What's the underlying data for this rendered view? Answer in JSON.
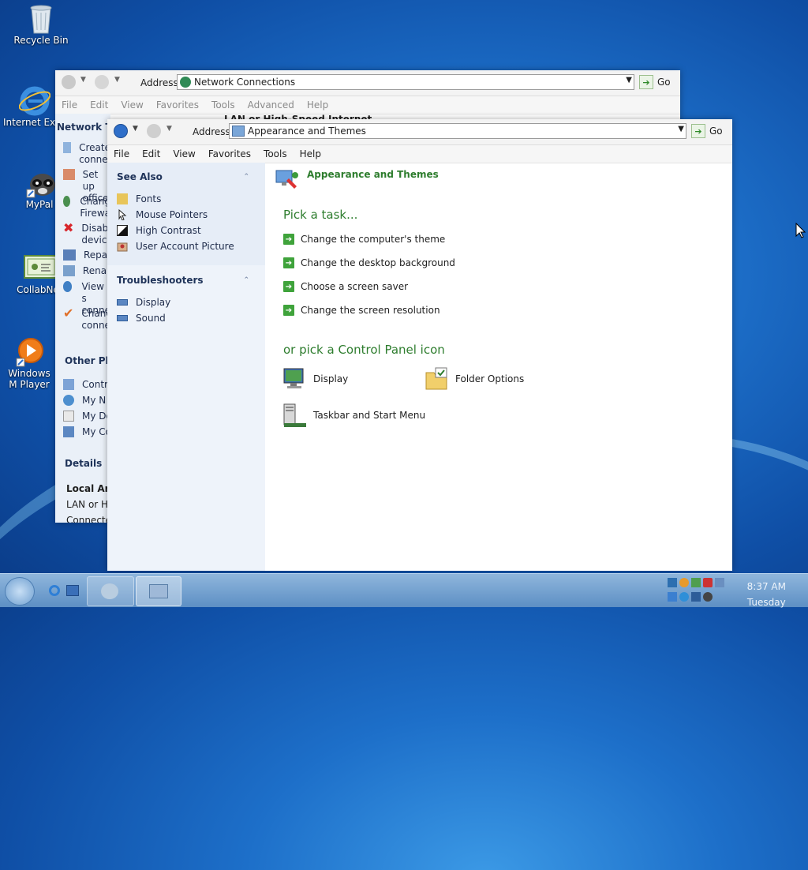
{
  "desktop": {
    "icons": [
      {
        "label": "Recycle Bin"
      },
      {
        "label": "Internet Expl"
      },
      {
        "label": "MyPal"
      },
      {
        "label": "CollabNe"
      },
      {
        "label": "Windows M Player"
      }
    ]
  },
  "back_window": {
    "address_label": "Address",
    "address_value": "Network Connections",
    "go_label": "Go",
    "menu": [
      "File",
      "Edit",
      "View",
      "Favorites",
      "Tools",
      "Advanced",
      "Help"
    ],
    "content_header": "LAN or High-Speed Internet",
    "sidebar": {
      "network_tasks_title": "Network Ta",
      "tasks": [
        [
          "Create",
          "conne"
        ],
        [
          "Set up",
          "office"
        ],
        [
          "Chang",
          "Firewa"
        ],
        [
          "Disab",
          "device"
        ],
        [
          "Repai"
        ],
        [
          "Renar"
        ],
        [
          "View s",
          "conne"
        ],
        [
          "Chanc",
          "conne"
        ]
      ],
      "other_places_title": "Other Plac",
      "other_places": [
        "Contr",
        "My N",
        "My Do",
        "My Co"
      ],
      "details_title": "Details",
      "details_name": "Local Are",
      "details_type": "LAN or Hi",
      "details_status": "Connecte"
    }
  },
  "front_window": {
    "address_label": "Address",
    "address_value": "Appearance and Themes",
    "go_label": "Go",
    "menu": [
      "File",
      "Edit",
      "View",
      "Favorites",
      "Tools",
      "Help"
    ],
    "sidebar": {
      "see_also_title": "See Also",
      "see_also": [
        "Fonts",
        "Mouse Pointers",
        "High Contrast",
        "User Account Picture"
      ],
      "troubleshooters_title": "Troubleshooters",
      "troubleshooters": [
        "Display",
        "Sound"
      ]
    },
    "content": {
      "category_title": "Appearance and Themes",
      "pick_task": "Pick a task...",
      "tasks": [
        "Change the computer's theme",
        "Change the desktop background",
        "Choose a screen saver",
        "Change the screen resolution"
      ],
      "pick_icon": "or pick a Control Panel icon",
      "icons": [
        "Display",
        "Folder Options",
        "Taskbar and Start Menu"
      ]
    }
  },
  "taskbar": {
    "time": "8:37 AM",
    "day": "Tuesday"
  }
}
